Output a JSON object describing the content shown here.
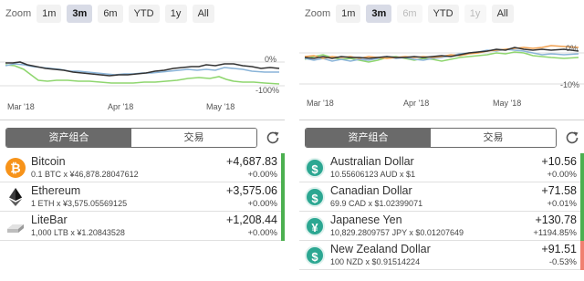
{
  "left": {
    "zoom": {
      "label": "Zoom",
      "options": [
        {
          "label": "1m",
          "state": "normal"
        },
        {
          "label": "3m",
          "state": "active"
        },
        {
          "label": "6m",
          "state": "normal"
        },
        {
          "label": "YTD",
          "state": "normal"
        },
        {
          "label": "1y",
          "state": "normal"
        },
        {
          "label": "All",
          "state": "normal"
        }
      ]
    },
    "chart": {
      "top_pct": "0%",
      "bottom_pct": "-100%",
      "months": [
        "Mar '18",
        "Apr '18",
        "May '18"
      ]
    },
    "tabs": {
      "active": "资产组合",
      "inactive": "交易"
    },
    "items": [
      {
        "name": "Bitcoin",
        "sub": "0.1 BTC x ¥46,878.28047612",
        "amount": "+4,687.83",
        "pct": "+0.00%",
        "icon": "bitcoin-icon",
        "trend": "up"
      },
      {
        "name": "Ethereum",
        "sub": "1 ETH x ¥3,575.05569125",
        "amount": "+3,575.06",
        "pct": "+0.00%",
        "icon": "ethereum-icon",
        "trend": "up"
      },
      {
        "name": "LiteBar",
        "sub": "1,000 LTB x ¥1.20843528",
        "amount": "+1,208.44",
        "pct": "+0.00%",
        "icon": "gold-bar-icon",
        "trend": "up"
      }
    ]
  },
  "right": {
    "zoom": {
      "label": "Zoom",
      "options": [
        {
          "label": "1m",
          "state": "normal"
        },
        {
          "label": "3m",
          "state": "active"
        },
        {
          "label": "6m",
          "state": "disabled"
        },
        {
          "label": "YTD",
          "state": "normal"
        },
        {
          "label": "1y",
          "state": "disabled"
        },
        {
          "label": "All",
          "state": "normal"
        }
      ]
    },
    "chart": {
      "top_pct": "0%",
      "bottom_pct": "-10%",
      "months": [
        "Mar '18",
        "Apr '18",
        "May '18"
      ]
    },
    "tabs": {
      "active": "资产组合",
      "inactive": "交易"
    },
    "items": [
      {
        "name": "Australian Dollar",
        "sub": "10.55606123 AUD x $1",
        "amount": "+10.56",
        "pct": "+0.00%",
        "icon": "dollar-icon",
        "glyph": "$",
        "trend": "up"
      },
      {
        "name": "Canadian Dollar",
        "sub": "69.9 CAD x $1.02399071",
        "amount": "+71.58",
        "pct": "+0.01%",
        "icon": "dollar-icon",
        "glyph": "$",
        "trend": "up"
      },
      {
        "name": "Japanese Yen",
        "sub": "10,829.2809757 JPY x $0.01207649",
        "amount": "+130.78",
        "pct": "+1194.85%",
        "icon": "yen-icon",
        "glyph": "¥",
        "trend": "up"
      },
      {
        "name": "New Zealand Dollar",
        "sub": "100 NZD x $0.91514224",
        "amount": "+91.51",
        "pct": "-0.53%",
        "icon": "dollar-icon",
        "glyph": "$",
        "trend": "down"
      }
    ]
  },
  "colors": {
    "up": "#4cb050",
    "down": "#f08070",
    "series_dark": "#333333",
    "series_blue": "#8ab4d8",
    "series_green": "#8fd66f",
    "series_orange": "#f0a050"
  }
}
